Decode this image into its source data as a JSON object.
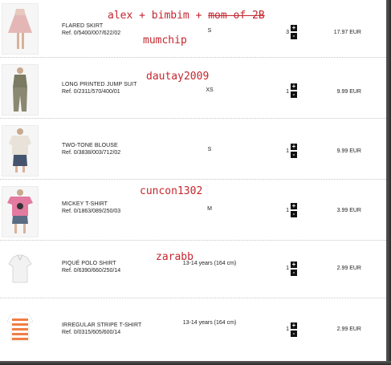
{
  "items": [
    {
      "name": "FLARED SKIRT",
      "ref": "Ref. 0/5400/007/622/02",
      "size": "S",
      "qty": "3",
      "price": "17.97 EUR",
      "plus": "+",
      "minus": "-",
      "icon": "flared-skirt-photo"
    },
    {
      "name": "LONG PRINTED JUMP SUIT",
      "ref": "Ref. 0/2311/570/400/01",
      "size": "XS",
      "qty": "1",
      "price": "9.99 EUR",
      "plus": "+",
      "minus": "-",
      "icon": "jump-suit-photo"
    },
    {
      "name": "TWO-TONE BLOUSE",
      "ref": "Ref. 0/3838/003/712/02",
      "size": "S",
      "qty": "1",
      "price": "9.99 EUR",
      "plus": "+",
      "minus": "-",
      "icon": "blouse-photo"
    },
    {
      "name": "MICKEY T-SHIRT",
      "ref": "Ref. 0/1863/089/250/03",
      "size": "M",
      "qty": "1",
      "price": "3.99 EUR",
      "plus": "+",
      "minus": "-",
      "icon": "mickey-tshirt-photo"
    },
    {
      "name": "PIQUÉ POLO SHIRT",
      "ref": "Ref. 0/6390/660/250/14",
      "size": "13-14 years (164 cm)",
      "qty": "1",
      "price": "2.99 EUR",
      "plus": "+",
      "minus": "-",
      "icon": "polo-shirt-photo"
    },
    {
      "name": "IRREGULAR STRIPE T-SHIRT",
      "ref": "Ref. 0/0315/605/600/14",
      "size": "13-14 years (164 cm)",
      "qty": "1",
      "price": "2.99 EUR",
      "plus": "+",
      "minus": "-",
      "icon": "stripe-tshirt-photo"
    }
  ],
  "annotations": {
    "a1_part1": "alex + bimbim + ",
    "a1_struck": "mom of 2B",
    "a2": "mumchip",
    "a3": "dautay2009",
    "a4": "cuncon1302",
    "a5": "zarabb"
  },
  "colors": {
    "annotation": "#c4262e",
    "text": "#222222",
    "stepper": "#111111",
    "divider": "#c4c4c4"
  }
}
